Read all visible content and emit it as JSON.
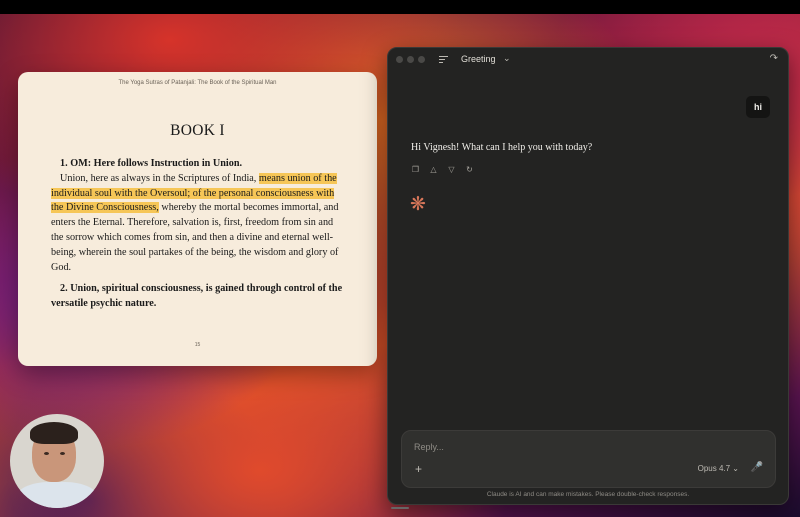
{
  "book": {
    "header": "The Yoga Sutras of Patanjali: The Book of the Spiritual Man",
    "chapter_title": "BOOK I",
    "sutra1_heading": "1. OM: Here follows Instruction in Union.",
    "para1_a": "Union, here as always in the Scriptures of India, ",
    "para1_highlight": "means union of the individual soul with the Oversoul; of the personal conscious­ness with the Divine Consciousness,",
    "para1_b": " whereby the mortal becomes immortal, and enters the Eternal. Therefore, salvation is, first, freedom from sin and the sorrow which comes from sin, and then a divine and eternal well-being, wherein the soul partakes of the being, the wisdom and glory of God.",
    "sutra2_heading": "2. Union, spiritual consciousness, is gained through con­trol of the versatile psychic nature.",
    "page_number": "15"
  },
  "claude": {
    "chat_title": "Greeting",
    "user_message": "hi",
    "assistant_message": "Hi Vignesh! What can I help you with today?",
    "composer_placeholder": "Reply...",
    "model_label": "Opus 4.7",
    "disclaimer": "Claude is AI and can make mistakes. Please double-check responses.",
    "action_icons": [
      "copy-icon",
      "thumbs-up-icon",
      "thumbs-down-icon",
      "retry-icon"
    ],
    "accent_color": "#d9775a"
  }
}
